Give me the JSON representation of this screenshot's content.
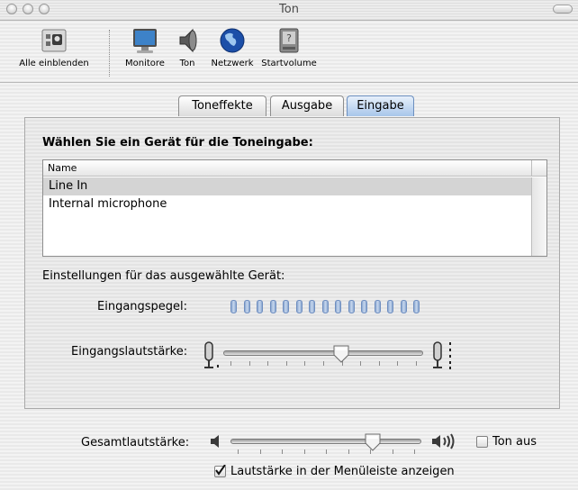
{
  "window": {
    "title": "Ton"
  },
  "toolbar": {
    "items": [
      {
        "label": "Alle einblenden",
        "icon": "show-all-icon"
      },
      {
        "label": "Monitore",
        "icon": "monitor-icon"
      },
      {
        "label": "Ton",
        "icon": "speaker-icon"
      },
      {
        "label": "Netzwerk",
        "icon": "globe-icon"
      },
      {
        "label": "Startvolume",
        "icon": "startup-disk-icon"
      }
    ]
  },
  "tabs": [
    {
      "label": "Toneffekte",
      "selected": false
    },
    {
      "label": "Ausgabe",
      "selected": false
    },
    {
      "label": "Eingabe",
      "selected": true
    }
  ],
  "input": {
    "section_title": "Wählen Sie ein Gerät für die Toneingabe:",
    "table_header": "Name",
    "devices": [
      {
        "name": "Line In",
        "selected": true
      },
      {
        "name": "Internal microphone",
        "selected": false
      }
    ],
    "settings_label": "Einstellungen für das ausgewählte Gerät:",
    "level_label": "Eingangspegel:",
    "level_leds": 15,
    "volume_label": "Eingangslautstärke:",
    "volume_value": 0.6
  },
  "output": {
    "master_label": "Gesamtlautstärke:",
    "master_value": 0.77,
    "mute_label": "Ton aus",
    "mute_checked": false,
    "menubar_label": "Lautstärke in der Menüleiste anzeigen",
    "menubar_checked": true
  },
  "colors": {
    "selection": "#d4d4d4",
    "led": "#8aa7cf",
    "tab_selected": "#a8c6ea"
  }
}
